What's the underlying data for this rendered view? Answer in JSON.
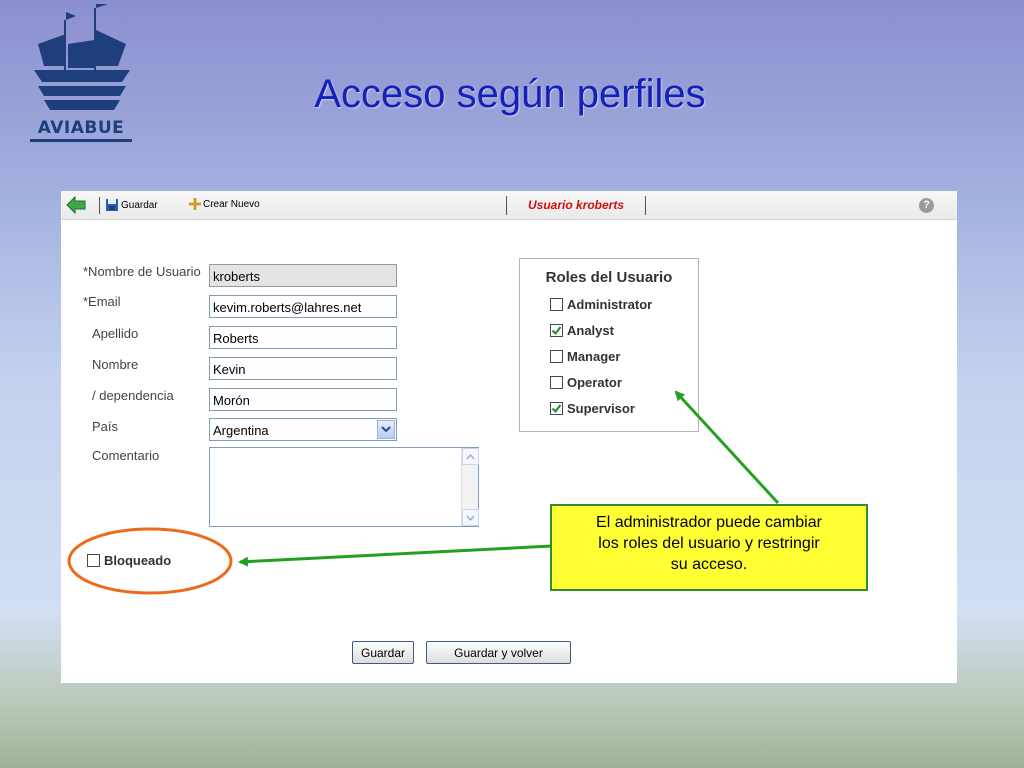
{
  "slide": {
    "title": "Acceso según perfiles",
    "logo_text": "AVIABUE"
  },
  "toolbar": {
    "back_icon": "arrow-left-icon",
    "save_label": "Guardar",
    "create_label": "Crear Nuevo",
    "user_title": "Usuario kroberts",
    "help_icon": "question-icon"
  },
  "form": {
    "fields": [
      {
        "label": "*Nombre de Usuario",
        "value": "kroberts"
      },
      {
        "label": "*Email",
        "value": "kevim.roberts@lahres.net"
      },
      {
        "label": "Apellido",
        "value": "Roberts"
      },
      {
        "label": "Nombre",
        "value": "Kevin"
      },
      {
        "label": "/ dependencia",
        "value": "Morón"
      },
      {
        "label": "País",
        "value": "Argentina"
      },
      {
        "label": "Comentario",
        "value": ""
      }
    ],
    "blocked": {
      "label": "Bloqueado",
      "checked": false
    }
  },
  "roles": {
    "title": "Roles del Usuario",
    "items": [
      {
        "label": "Administrator",
        "checked": false
      },
      {
        "label": "Analyst",
        "checked": true
      },
      {
        "label": "Manager",
        "checked": false
      },
      {
        "label": "Operator",
        "checked": false
      },
      {
        "label": "Supervisor",
        "checked": true
      }
    ]
  },
  "buttons": {
    "save": "Guardar",
    "save_back": "Guardar y volver"
  },
  "annotation": {
    "line1": "El administrador puede cambiar",
    "line2": "los roles del usuario y restringir",
    "line3": "su acceso."
  },
  "colors": {
    "title": "#1520b8",
    "user_title": "#cc1111",
    "callout_bg": "#ffff33",
    "arrow": "#22a022",
    "highlight": "#ee6a1a"
  }
}
